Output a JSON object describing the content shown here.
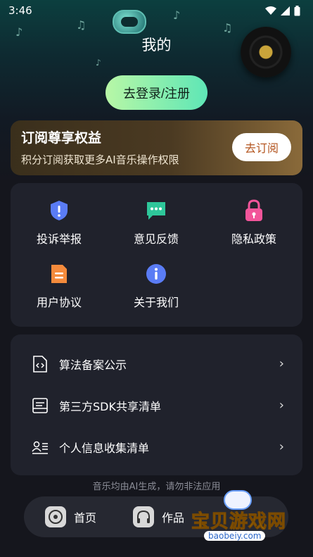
{
  "status": {
    "time": "3:46"
  },
  "header": {
    "title": "我的",
    "login_label": "去登录/注册"
  },
  "subscription": {
    "title": "订阅尊享权益",
    "description": "积分订阅获取更多AI音乐操作权限",
    "button_label": "去订阅"
  },
  "grid": {
    "items": [
      {
        "label": "投诉举报",
        "icon": "shield-alert-icon",
        "color": "#5a7cf5"
      },
      {
        "label": "意见反馈",
        "icon": "chat-bubble-icon",
        "color": "#2ec79a"
      },
      {
        "label": "隐私政策",
        "icon": "lock-icon",
        "color": "#f2559a"
      },
      {
        "label": "用户协议",
        "icon": "document-icon",
        "color": "#f58b3c"
      },
      {
        "label": "关于我们",
        "icon": "info-icon",
        "color": "#5a7cf5"
      }
    ]
  },
  "list": {
    "items": [
      {
        "label": "算法备案公示",
        "icon": "code-file-icon"
      },
      {
        "label": "第三方SDK共享清单",
        "icon": "clipboard-list-icon"
      },
      {
        "label": "个人信息收集清单",
        "icon": "id-card-icon"
      }
    ]
  },
  "footer": {
    "note": "音乐均由AI生成，请勿非法应用"
  },
  "tabbar": {
    "tabs": [
      {
        "label": "首页",
        "icon": "disc-icon"
      },
      {
        "label": "作品",
        "icon": "headphones-icon"
      }
    ]
  },
  "watermark": {
    "text": "宝贝游戏网",
    "url": "baobeiy.com"
  }
}
